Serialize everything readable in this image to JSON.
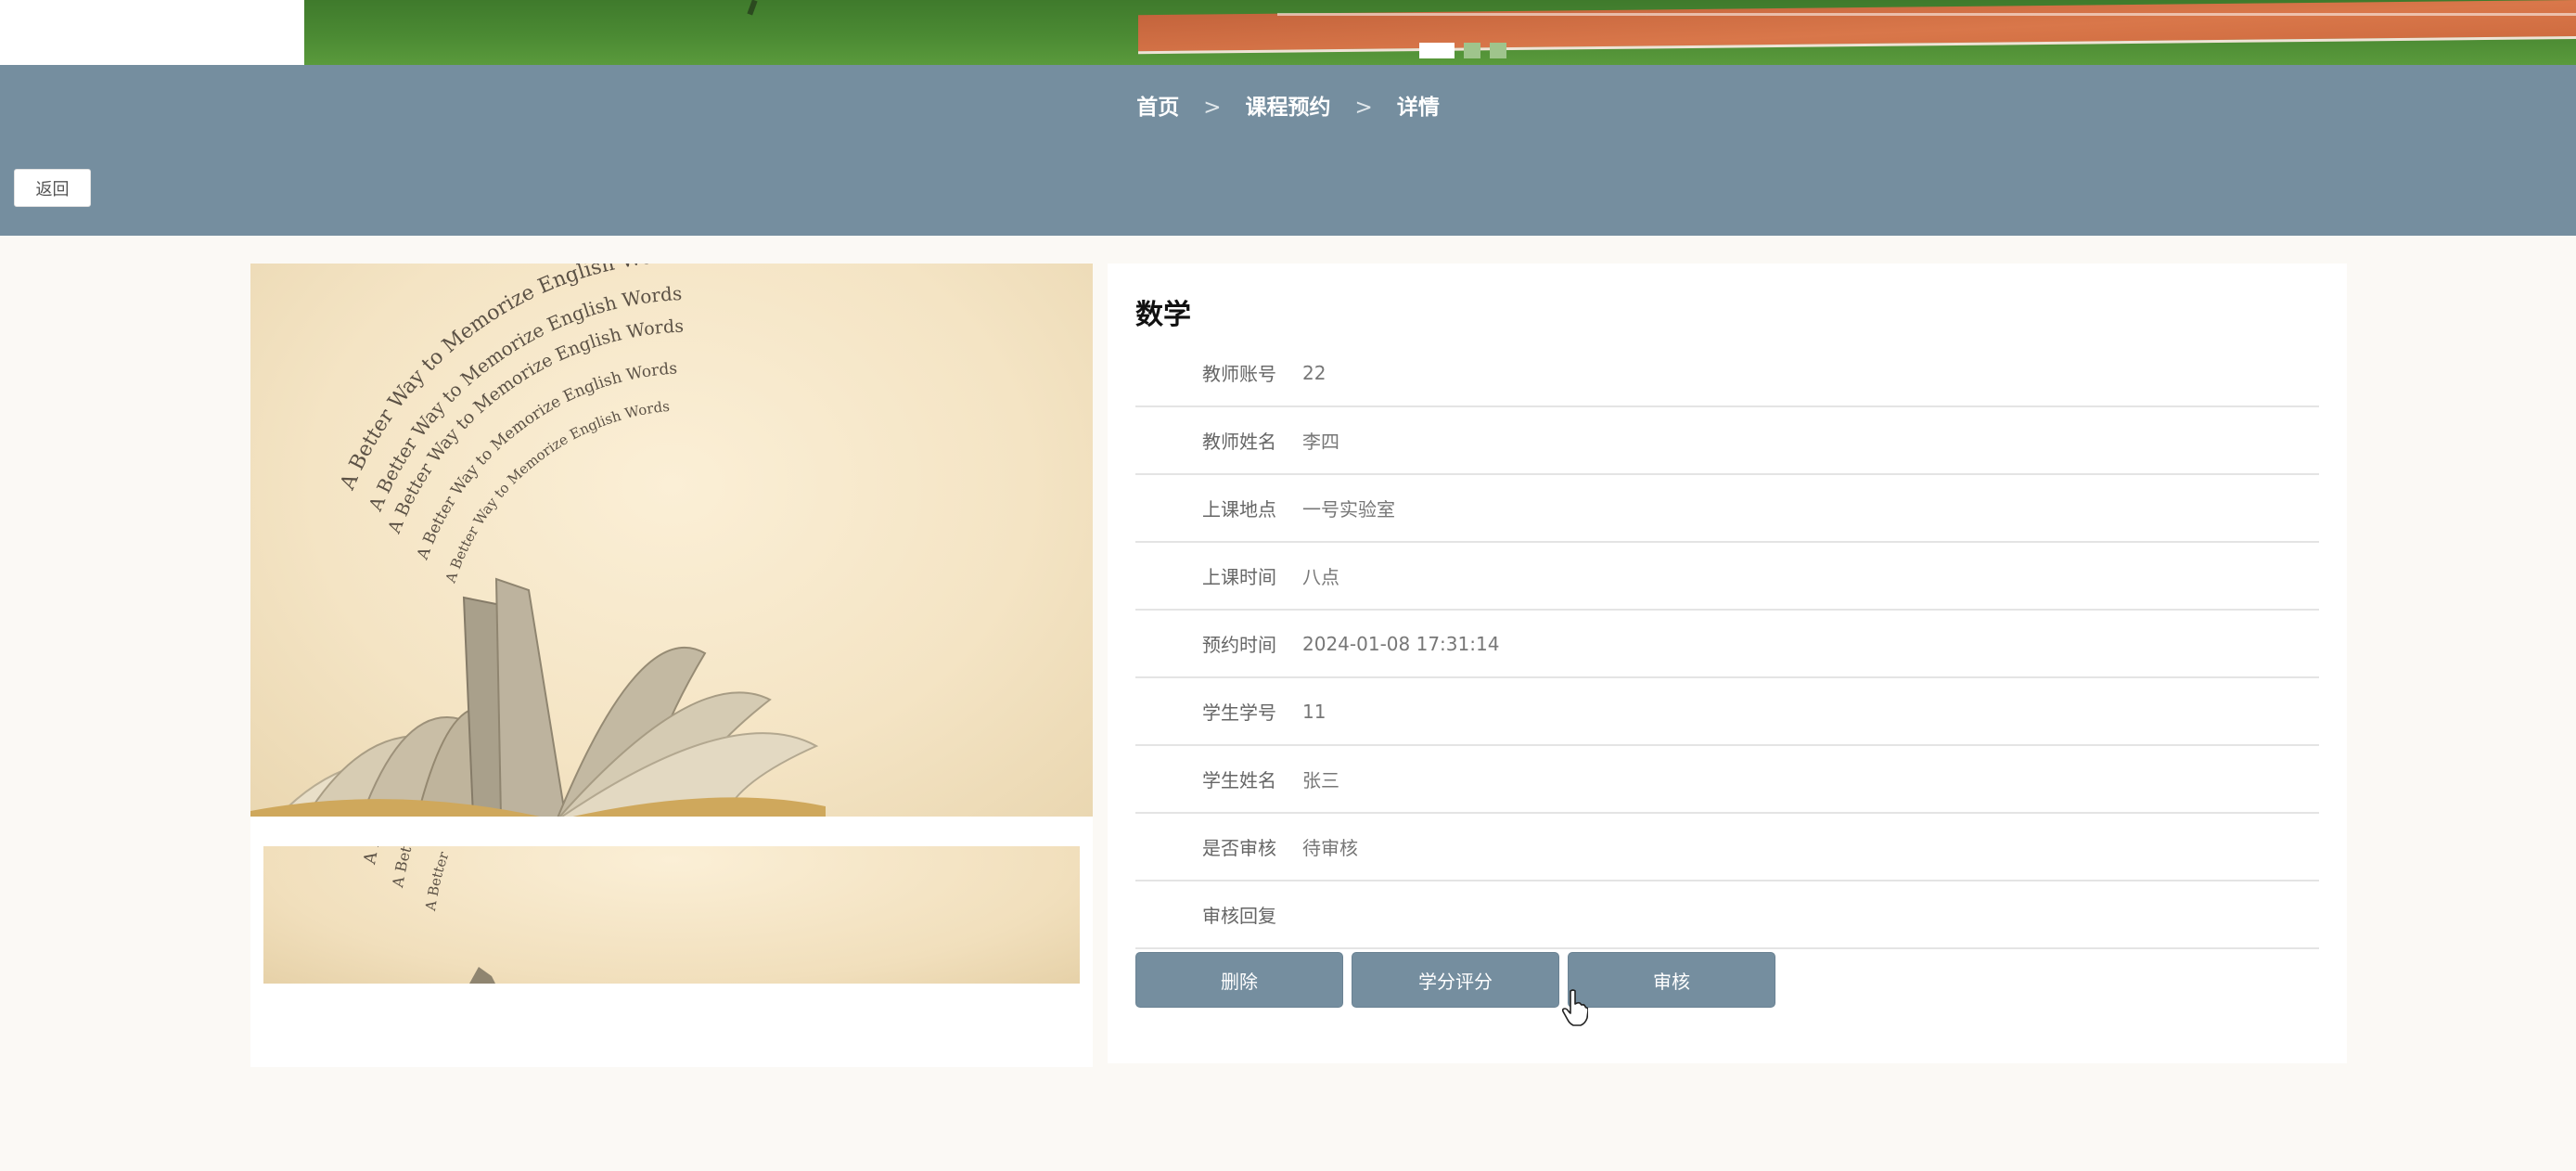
{
  "breadcrumb": {
    "home": "首页",
    "section": "课程预约",
    "current": "详情",
    "separator": ">"
  },
  "back_button": {
    "label": "返回"
  },
  "banner": {
    "slide_count": 3,
    "active_slide": 1
  },
  "images": {
    "main_text": "A Better Way to Memorize English Words",
    "thumb_text": "A Better Way to Memorize English Words"
  },
  "detail": {
    "title": "数学",
    "fields": [
      {
        "label": "教师账号",
        "value": "22"
      },
      {
        "label": "教师姓名",
        "value": "李四"
      },
      {
        "label": "上课地点",
        "value": "一号实验室"
      },
      {
        "label": "上课时间",
        "value": "八点"
      },
      {
        "label": "预约时间",
        "value": "2024-01-08 17:31:14"
      },
      {
        "label": "学生学号",
        "value": "11"
      },
      {
        "label": "学生姓名",
        "value": "张三"
      },
      {
        "label": "是否审核",
        "value": "待审核"
      },
      {
        "label": "审核回复",
        "value": ""
      }
    ]
  },
  "actions": {
    "delete": "删除",
    "grade": "学分评分",
    "review": "审核"
  },
  "colors": {
    "header": "#758e9f",
    "page_bg": "#fbf9f5",
    "button": "#758e9f"
  }
}
